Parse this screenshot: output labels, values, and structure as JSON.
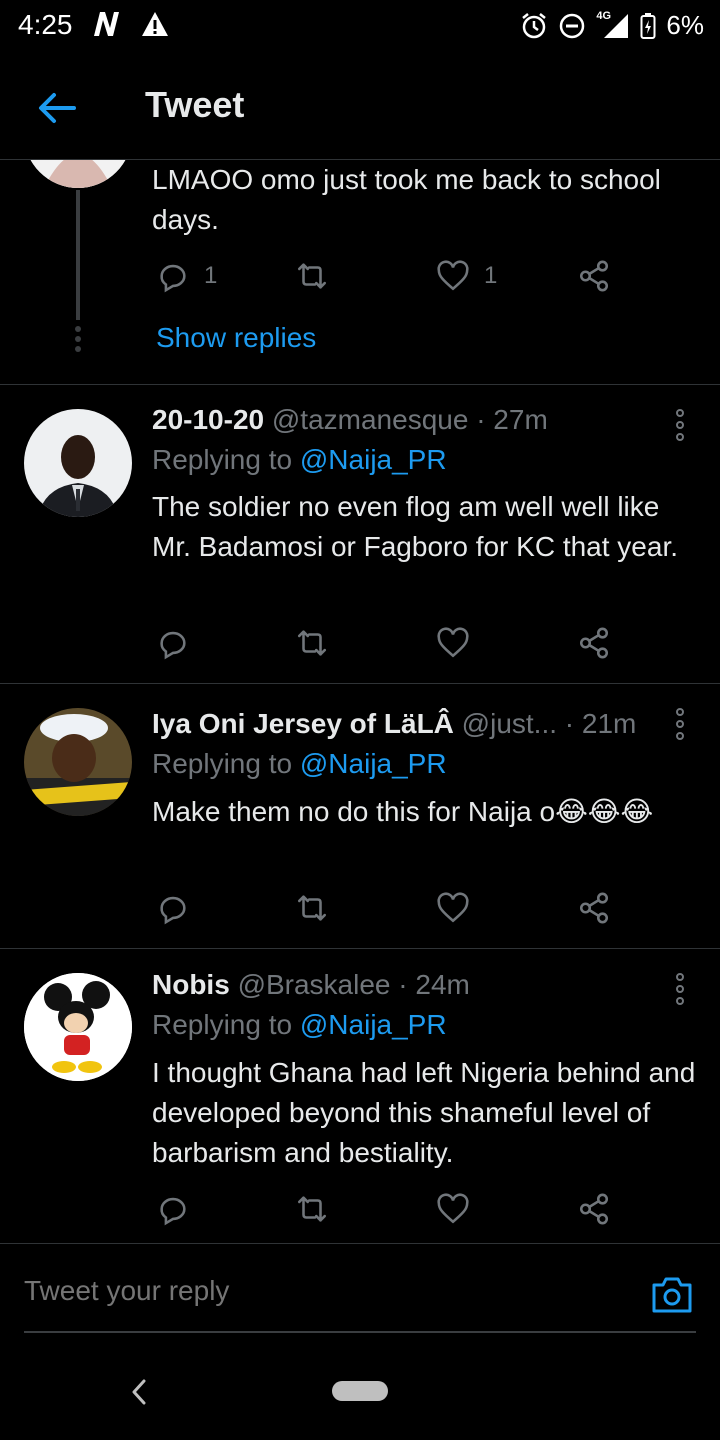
{
  "status_bar": {
    "time": "4:25",
    "network": "4G",
    "battery": "6%"
  },
  "header": {
    "title": "Tweet"
  },
  "thread_continuation": {
    "text": "LMAOO omo  just took me back to school days.",
    "reply_count": "1",
    "like_count": "1",
    "show_replies_label": "Show replies"
  },
  "tweets": [
    {
      "display_name": "20-10-20",
      "handle": "@tazmanesque",
      "time": "· 27m",
      "replying_prefix": "Replying to",
      "replying_to": "@Naija_PR",
      "text": "The soldier no even flog am well well like Mr. Badamosi or Fagboro for KC that year."
    },
    {
      "display_name": "Iya Oni Jersey of LäLÂ",
      "handle": "@just...",
      "time": "· 21m",
      "replying_prefix": "Replying to",
      "replying_to": "@Naija_PR",
      "text": "Make them no do this for Naija o😂😂😂"
    },
    {
      "display_name": "Nobis",
      "handle": "@Braskalee",
      "time": "· 24m",
      "replying_prefix": "Replying to",
      "replying_to": "@Naija_PR",
      "text": "I thought Ghana had left Nigeria behind and developed beyond this shameful level of barbarism and bestiality."
    }
  ],
  "reply_bar": {
    "placeholder": "Tweet your reply"
  },
  "colors": {
    "accent": "#1d9bf0",
    "background": "#000000",
    "secondary_text": "#71767b",
    "divider": "#2f3336"
  }
}
